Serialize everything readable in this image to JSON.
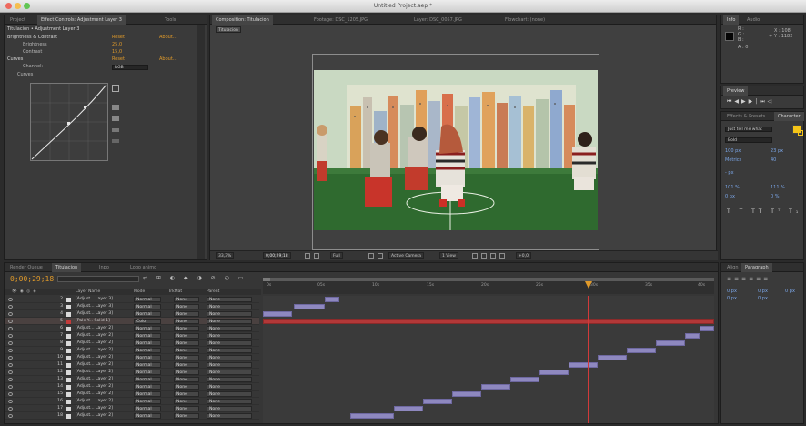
{
  "window": {
    "title": "Untitled Project.aep *"
  },
  "left_panel": {
    "tabs": [
      "Project",
      "Effect Controls: Adjustment Layer 3",
      "Tools"
    ],
    "breadcrumb": "Titulacion • Adjustment Layer 3",
    "effects": [
      {
        "name": "Brightness & Contrast",
        "reset": "Reset",
        "about": "About..."
      },
      {
        "name": "Curves",
        "reset": "Reset",
        "about": "About..."
      }
    ],
    "brightness": {
      "label": "Brightness",
      "value": "25,0"
    },
    "contrast": {
      "label": "Contrast",
      "value": "15,0"
    },
    "channel": {
      "label": "Channel:",
      "value": "RGB"
    },
    "curves_label": "Curves"
  },
  "comp_panel": {
    "tabs": [
      "Composition: Titulacion",
      "Footage: DSC_1205.JPG",
      "Layer: DSC_0057.JPG",
      "Flowchart: (none)"
    ],
    "comp_tab": "Titulacion",
    "footer": {
      "zoom": "33,3%",
      "timecode": "0;00;29;18",
      "resolution": "Full",
      "camera": "Active Camera",
      "view": "1 View",
      "offset": "+0,0"
    }
  },
  "right_panels": {
    "info_tabs": [
      "Info",
      "Audio"
    ],
    "info": {
      "r": "R :",
      "g": "G :",
      "b": "B :",
      "a": "A : 0",
      "x": "X : 108",
      "y": "+ Y : 1182"
    },
    "preview_tab": "Preview",
    "effects_tab": "Effects & Presets",
    "character_tab": "Character",
    "font": "Just tell me what",
    "font_style": "Bold",
    "size": "100 px",
    "leading": "23 px",
    "kerning": "Metrics",
    "tracking": "40",
    "stroke": "- px",
    "vscale": "101 %",
    "hscale": "111 %",
    "baseline": "0 px",
    "tsume": "0 %",
    "align_tabs": [
      "Align",
      "Paragraph"
    ],
    "para": {
      "indent_left": "0 px",
      "indent_right": "0 px",
      "space_before": "0 px",
      "space_after": "0 px",
      "first": "0 px"
    }
  },
  "timeline": {
    "tabs": [
      "Render Queue",
      "Titulacion",
      "Inpo",
      "Logo animo"
    ],
    "timecode": "0;00;29;18",
    "columns": [
      "Layer Name",
      "Mode",
      "T TrkMat",
      "Parent"
    ],
    "ruler": [
      "0s",
      "05s",
      "10s",
      "15s",
      "20s",
      "25s",
      "30s",
      "35s",
      "40s"
    ],
    "layers": [
      {
        "num": "2",
        "name": "[Adjust... Layer 3]",
        "mode": "Normal",
        "trkmat": "None",
        "parent": "None",
        "color": "#d9d9d9"
      },
      {
        "num": "3",
        "name": "[Adjust... Layer 3]",
        "mode": "Normal",
        "trkmat": "None",
        "parent": "None",
        "color": "#d9d9d9"
      },
      {
        "num": "4",
        "name": "[Adjust... Layer 3]",
        "mode": "Normal",
        "trkmat": "None",
        "parent": "None",
        "color": "#d9d9d9"
      },
      {
        "num": "5",
        "name": "[Pale Y... Solid 1]",
        "mode": "Color",
        "trkmat": "None",
        "parent": "None",
        "color": "#c23a3a"
      },
      {
        "num": "6",
        "name": "[Adjust... Layer 2]",
        "mode": "Normal",
        "trkmat": "None",
        "parent": "None",
        "color": "#d9d9d9"
      },
      {
        "num": "7",
        "name": "[Adjust... Layer 2]",
        "mode": "Normal",
        "trkmat": "None",
        "parent": "None",
        "color": "#d9d9d9"
      },
      {
        "num": "8",
        "name": "[Adjust... Layer 2]",
        "mode": "Normal",
        "trkmat": "None",
        "parent": "None",
        "color": "#d9d9d9"
      },
      {
        "num": "9",
        "name": "[Adjust... Layer 2]",
        "mode": "Normal",
        "trkmat": "None",
        "parent": "None",
        "color": "#d9d9d9"
      },
      {
        "num": "10",
        "name": "[Adjust... Layer 2]",
        "mode": "Normal",
        "trkmat": "None",
        "parent": "None",
        "color": "#d9d9d9"
      },
      {
        "num": "11",
        "name": "[Adjust... Layer 2]",
        "mode": "Normal",
        "trkmat": "None",
        "parent": "None",
        "color": "#d9d9d9"
      },
      {
        "num": "12",
        "name": "[Adjust... Layer 2]",
        "mode": "Normal",
        "trkmat": "None",
        "parent": "None",
        "color": "#d9d9d9"
      },
      {
        "num": "13",
        "name": "[Adjust... Layer 2]",
        "mode": "Normal",
        "trkmat": "None",
        "parent": "None",
        "color": "#d9d9d9"
      },
      {
        "num": "14",
        "name": "[Adjust... Layer 2]",
        "mode": "Normal",
        "trkmat": "None",
        "parent": "None",
        "color": "#d9d9d9"
      },
      {
        "num": "15",
        "name": "[Adjust... Layer 2]",
        "mode": "Normal",
        "trkmat": "None",
        "parent": "None",
        "color": "#d9d9d9"
      },
      {
        "num": "16",
        "name": "[Adjust... Layer 2]",
        "mode": "Normal",
        "trkmat": "None",
        "parent": "None",
        "color": "#d9d9d9"
      },
      {
        "num": "17",
        "name": "[Adjust... Layer 2]",
        "mode": "Normal",
        "trkmat": "None",
        "parent": "None",
        "color": "#d9d9d9"
      },
      {
        "num": "18",
        "name": "[Adjust... Layer 2]",
        "mode": "Normal",
        "trkmat": "None",
        "parent": "None",
        "color": "#d9d9d9"
      }
    ]
  }
}
